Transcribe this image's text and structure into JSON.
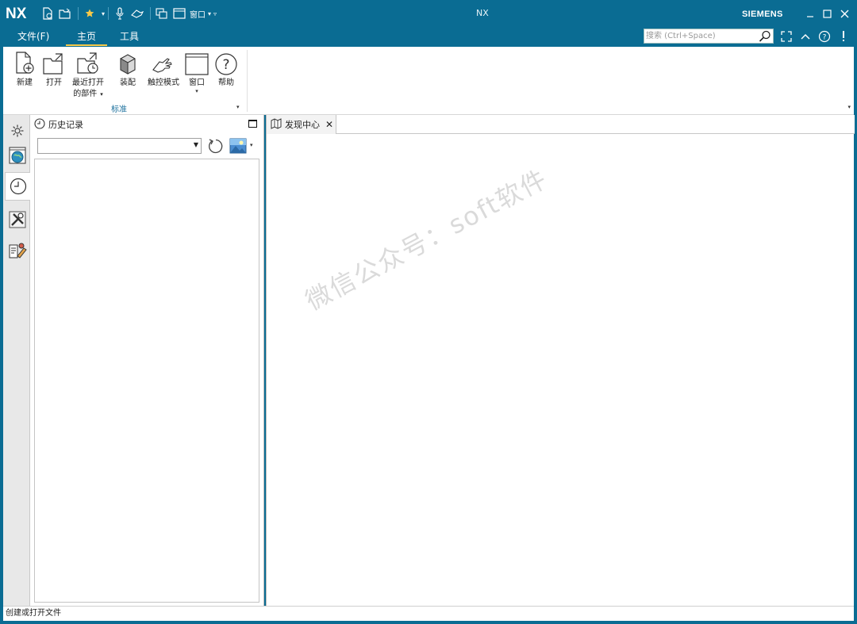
{
  "titlebar": {
    "logo": "NX",
    "title": "NX",
    "brand": "SIEMENS",
    "window_label": "窗口"
  },
  "menu": {
    "tabs": [
      {
        "label": "文件(F)"
      },
      {
        "label": "主页"
      },
      {
        "label": "工具"
      }
    ],
    "active_tab": "主页"
  },
  "search": {
    "placeholder": "搜索 (Ctrl+Space)"
  },
  "ribbon": {
    "group_label": "标准",
    "buttons": [
      {
        "label": "新建",
        "icon": "new-file-icon"
      },
      {
        "label": "打开",
        "icon": "open-folder-icon"
      },
      {
        "label": "最近打开",
        "label2": "的部件",
        "icon": "recent-parts-icon"
      },
      {
        "label": "装配",
        "icon": "assembly-icon"
      },
      {
        "label": "触控模式",
        "icon": "touch-mode-icon"
      },
      {
        "label": "窗口",
        "icon": "window-icon"
      },
      {
        "label": "帮助",
        "icon": "help-icon"
      }
    ]
  },
  "resource_bar": {
    "items": [
      "settings-icon",
      "web-browser-icon",
      "history-icon",
      "tools-icon",
      "roles-icon"
    ],
    "active": "history-icon"
  },
  "history_panel": {
    "title": "历史记录",
    "select_value": ""
  },
  "doc_tabs": [
    {
      "label": "发现中心"
    }
  ],
  "watermark": "微信公众号：soft软件",
  "status": {
    "text": "创建或打开文件"
  },
  "colors": {
    "titlebar": "#0a6c93",
    "active_tab_underline": "#f7c948",
    "accent_text": "#1a6f9c"
  }
}
